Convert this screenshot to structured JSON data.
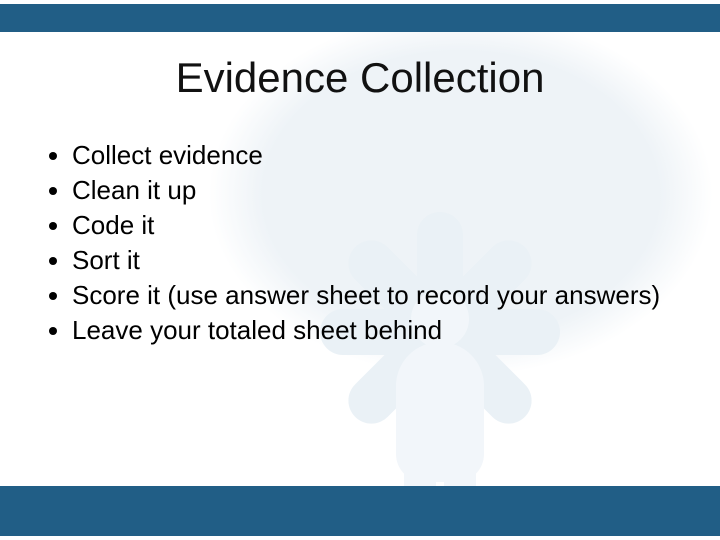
{
  "title": "Evidence Collection",
  "bullets": [
    "Collect evidence",
    "Clean it up",
    "Code it",
    "Sort it",
    "Score it (use answer sheet to record your answers)",
    "Leave your totaled sheet behind"
  ]
}
